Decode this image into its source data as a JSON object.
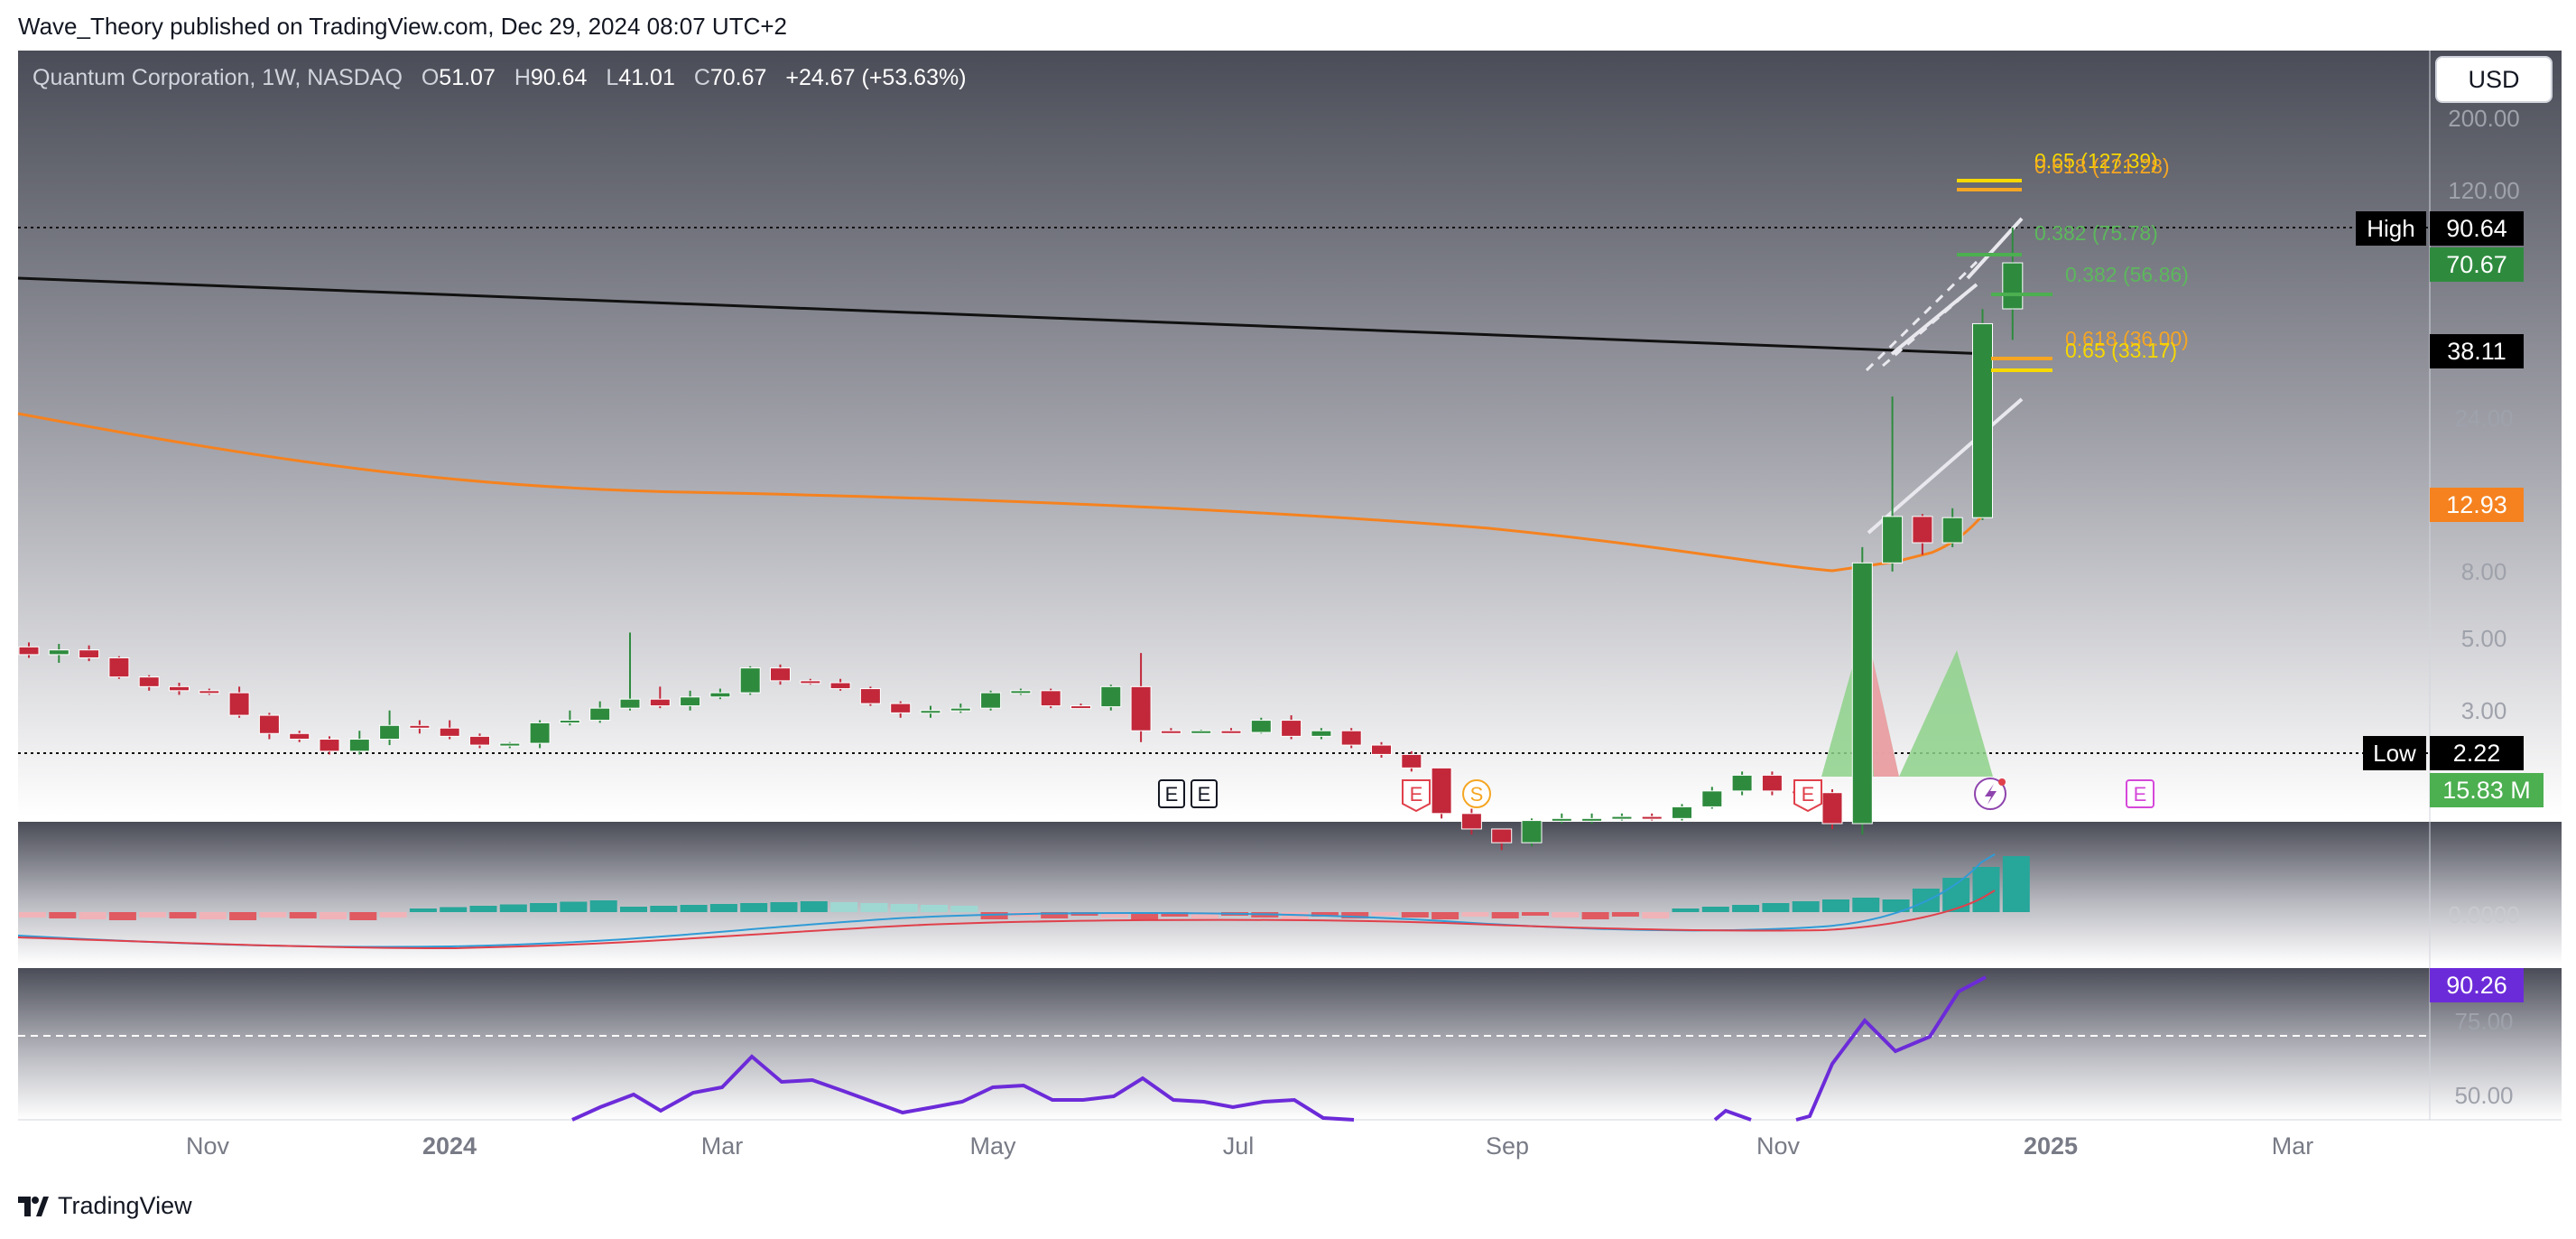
{
  "header": {
    "published_text": "Wave_Theory published on TradingView.com, Dec 29, 2024 08:07 UTC+2"
  },
  "legend": {
    "symbol": "Quantum Corporation, 1W, NASDAQ",
    "o_label": "O",
    "o_val": "51.07",
    "h_label": "H",
    "h_val": "90.64",
    "l_label": "L",
    "l_val": "41.01",
    "c_label": "C",
    "c_val": "70.67",
    "change": "+24.67 (+53.63%)"
  },
  "currency_button": "USD",
  "footer": {
    "logo_text": "TradingView"
  },
  "colors": {
    "up": "#2e8b3e",
    "down": "#c2283a",
    "ema": "#f5821f",
    "trendline": "#111111",
    "macd_line": "#2f9bd6",
    "signal_line": "#e0404b",
    "rsi_line": "#6c2bd9",
    "fib_orange": "#f5a623",
    "fib_yellow": "#f7d800",
    "fib_green": "#4caf50"
  },
  "price_axis": {
    "ticks": [
      "200.00",
      "120.00",
      "24.00",
      "8.00",
      "5.00",
      "3.00"
    ],
    "badges": {
      "high_label": "High",
      "high_value": "90.64",
      "last_value": "70.67",
      "trend_value": "38.11",
      "ema_value": "12.93",
      "low_label": "Low",
      "low_value": "2.22",
      "volume_value": "15.83 M"
    }
  },
  "fib_labels": {
    "f1": "0.65 (127.39)",
    "f2": "0.618 (121.28)",
    "f3": "0.382 (75.78)",
    "f4": "0.382 (56.86)",
    "f5": "0.618 (36.00)",
    "f6": "0.65 (33.17)"
  },
  "macd_axis": {
    "tick": "0.0000"
  },
  "rsi_axis": {
    "value_badge": "90.26",
    "ticks": [
      "75.00",
      "50.00"
    ]
  },
  "time_axis": {
    "labels": [
      "Nov",
      "2024",
      "Mar",
      "May",
      "Jul",
      "Sep",
      "Nov",
      "2025",
      "Mar"
    ]
  },
  "event_markers": [
    "E",
    "E",
    "E",
    "S",
    "E",
    "E"
  ],
  "chart_data": {
    "type": "candlestick",
    "title": "Quantum Corporation, 1W, NASDAQ",
    "scale": "log",
    "ylim": [
      2.0,
      230.0
    ],
    "grid": false,
    "legend_position": "top-left",
    "candles": [
      {
        "o": 4.7,
        "h": 4.85,
        "l": 4.35,
        "c": 4.45
      },
      {
        "o": 4.45,
        "h": 4.8,
        "l": 4.2,
        "c": 4.6
      },
      {
        "o": 4.6,
        "h": 4.75,
        "l": 4.25,
        "c": 4.35
      },
      {
        "o": 4.35,
        "h": 4.4,
        "l": 3.75,
        "c": 3.8
      },
      {
        "o": 3.8,
        "h": 3.85,
        "l": 3.45,
        "c": 3.55
      },
      {
        "o": 3.55,
        "h": 3.65,
        "l": 3.35,
        "c": 3.45
      },
      {
        "o": 3.45,
        "h": 3.5,
        "l": 3.35,
        "c": 3.4
      },
      {
        "o": 3.4,
        "h": 3.55,
        "l": 2.85,
        "c": 2.9
      },
      {
        "o": 2.9,
        "h": 2.95,
        "l": 2.45,
        "c": 2.55
      },
      {
        "o": 2.55,
        "h": 2.6,
        "l": 2.4,
        "c": 2.45
      },
      {
        "o": 2.45,
        "h": 2.5,
        "l": 2.2,
        "c": 2.25
      },
      {
        "o": 2.25,
        "h": 2.6,
        "l": 2.2,
        "c": 2.45
      },
      {
        "o": 2.45,
        "h": 3.0,
        "l": 2.35,
        "c": 2.7
      },
      {
        "o": 2.7,
        "h": 2.8,
        "l": 2.55,
        "c": 2.65
      },
      {
        "o": 2.65,
        "h": 2.8,
        "l": 2.45,
        "c": 2.5
      },
      {
        "o": 2.5,
        "h": 2.55,
        "l": 2.3,
        "c": 2.35
      },
      {
        "o": 2.35,
        "h": 2.4,
        "l": 2.3,
        "c": 2.38
      },
      {
        "o": 2.38,
        "h": 2.8,
        "l": 2.3,
        "c": 2.75
      },
      {
        "o": 2.75,
        "h": 3.0,
        "l": 2.7,
        "c": 2.8
      },
      {
        "o": 2.8,
        "h": 3.2,
        "l": 2.75,
        "c": 3.05
      },
      {
        "o": 3.05,
        "h": 5.2,
        "l": 3.0,
        "c": 3.25
      },
      {
        "o": 3.25,
        "h": 3.55,
        "l": 3.05,
        "c": 3.1
      },
      {
        "o": 3.1,
        "h": 3.45,
        "l": 3.0,
        "c": 3.3
      },
      {
        "o": 3.3,
        "h": 3.5,
        "l": 3.25,
        "c": 3.4
      },
      {
        "o": 3.4,
        "h": 4.1,
        "l": 3.35,
        "c": 4.05
      },
      {
        "o": 4.05,
        "h": 4.15,
        "l": 3.6,
        "c": 3.7
      },
      {
        "o": 3.7,
        "h": 3.75,
        "l": 3.6,
        "c": 3.65
      },
      {
        "o": 3.65,
        "h": 3.75,
        "l": 3.45,
        "c": 3.5
      },
      {
        "o": 3.5,
        "h": 3.55,
        "l": 3.1,
        "c": 3.15
      },
      {
        "o": 3.15,
        "h": 3.2,
        "l": 2.85,
        "c": 2.95
      },
      {
        "o": 2.95,
        "h": 3.1,
        "l": 2.85,
        "c": 3.0
      },
      {
        "o": 3.0,
        "h": 3.15,
        "l": 2.95,
        "c": 3.05
      },
      {
        "o": 3.05,
        "h": 3.45,
        "l": 3.0,
        "c": 3.4
      },
      {
        "o": 3.4,
        "h": 3.5,
        "l": 3.35,
        "c": 3.45
      },
      {
        "o": 3.45,
        "h": 3.5,
        "l": 3.05,
        "c": 3.1
      },
      {
        "o": 3.1,
        "h": 3.15,
        "l": 3.05,
        "c": 3.08
      },
      {
        "o": 3.08,
        "h": 3.6,
        "l": 3.0,
        "c": 3.55
      },
      {
        "o": 3.55,
        "h": 4.5,
        "l": 2.4,
        "c": 2.6
      },
      {
        "o": 2.6,
        "h": 2.65,
        "l": 2.55,
        "c": 2.58
      },
      {
        "o": 2.58,
        "h": 2.62,
        "l": 2.55,
        "c": 2.6
      },
      {
        "o": 2.6,
        "h": 2.65,
        "l": 2.55,
        "c": 2.57
      },
      {
        "o": 2.57,
        "h": 2.85,
        "l": 2.55,
        "c": 2.8
      },
      {
        "o": 2.8,
        "h": 2.9,
        "l": 2.45,
        "c": 2.5
      },
      {
        "o": 2.5,
        "h": 2.65,
        "l": 2.45,
        "c": 2.6
      },
      {
        "o": 2.6,
        "h": 2.65,
        "l": 2.3,
        "c": 2.35
      },
      {
        "o": 2.35,
        "h": 2.4,
        "l": 2.15,
        "c": 2.2
      },
      {
        "o": 2.2,
        "h": 2.25,
        "l": 1.95,
        "c": 2.0
      },
      {
        "o": 2.0,
        "h": 2.0,
        "l": 1.4,
        "c": 1.45
      },
      {
        "o": 1.45,
        "h": 1.5,
        "l": 1.25,
        "c": 1.3
      },
      {
        "o": 1.3,
        "h": 1.3,
        "l": 1.12,
        "c": 1.18
      },
      {
        "o": 1.18,
        "h": 1.4,
        "l": 1.15,
        "c": 1.38
      },
      {
        "o": 1.38,
        "h": 1.45,
        "l": 1.35,
        "c": 1.4
      },
      {
        "o": 1.4,
        "h": 1.45,
        "l": 1.35,
        "c": 1.4
      },
      {
        "o": 1.4,
        "h": 1.45,
        "l": 1.38,
        "c": 1.42
      },
      {
        "o": 1.42,
        "h": 1.45,
        "l": 1.38,
        "c": 1.4
      },
      {
        "o": 1.4,
        "h": 1.55,
        "l": 1.38,
        "c": 1.52
      },
      {
        "o": 1.52,
        "h": 1.75,
        "l": 1.5,
        "c": 1.7
      },
      {
        "o": 1.7,
        "h": 1.95,
        "l": 1.65,
        "c": 1.9
      },
      {
        "o": 1.9,
        "h": 1.95,
        "l": 1.65,
        "c": 1.7
      },
      {
        "o": 1.7,
        "h": 1.72,
        "l": 1.65,
        "c": 1.68
      },
      {
        "o": 1.68,
        "h": 1.72,
        "l": 1.3,
        "c": 1.35
      },
      {
        "o": 1.35,
        "h": 9.5,
        "l": 1.25,
        "c": 8.5
      },
      {
        "o": 8.5,
        "h": 27.5,
        "l": 8.0,
        "c": 11.8
      },
      {
        "o": 11.8,
        "h": 12.0,
        "l": 9.0,
        "c": 9.8
      },
      {
        "o": 9.8,
        "h": 12.5,
        "l": 9.5,
        "c": 11.7
      },
      {
        "o": 11.7,
        "h": 51.0,
        "l": 11.5,
        "c": 46.0
      },
      {
        "o": 51.07,
        "h": 90.64,
        "l": 41.01,
        "c": 70.67
      }
    ],
    "ema_value_last": 12.93,
    "trendline_value_last": 38.11,
    "high": 90.64,
    "low": 2.22,
    "volume_last": "15.83 M",
    "macd": {
      "zero_label": "0.0000"
    },
    "rsi": {
      "last": 90.26,
      "levels": [
        75,
        50
      ]
    }
  }
}
